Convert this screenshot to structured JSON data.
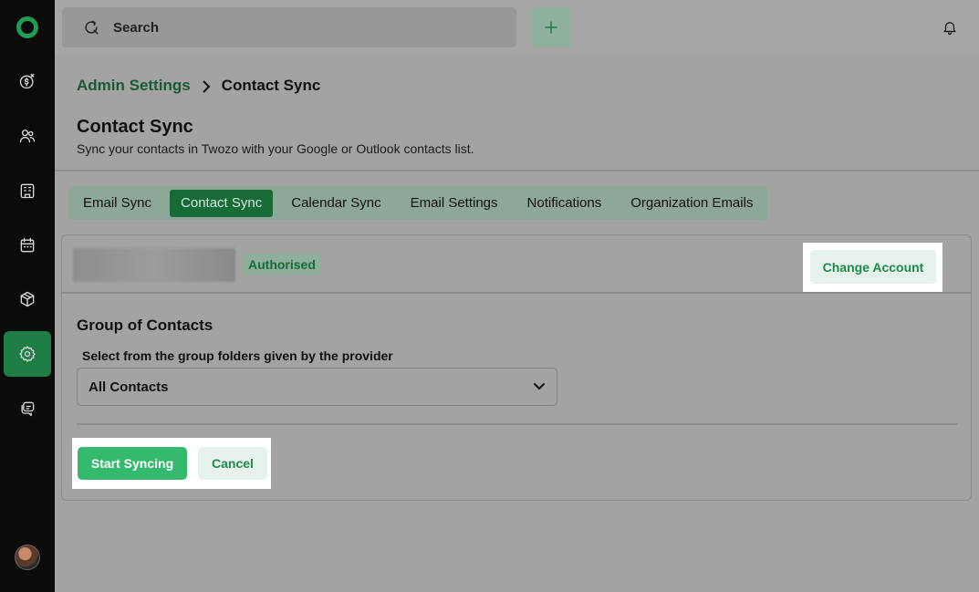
{
  "topbar": {
    "search_placeholder": "Search",
    "add_icon": "plus-icon",
    "bell_icon": "bell-icon"
  },
  "sidebar": {
    "items": [
      {
        "name": "deals",
        "icon": "dollar-icon"
      },
      {
        "name": "contacts",
        "icon": "users-icon"
      },
      {
        "name": "companies",
        "icon": "building-icon"
      },
      {
        "name": "calendar",
        "icon": "calendar-icon"
      },
      {
        "name": "products",
        "icon": "box-icon"
      },
      {
        "name": "settings",
        "icon": "gear-icon",
        "active": true
      },
      {
        "name": "chat",
        "icon": "chat-icon"
      }
    ]
  },
  "breadcrumb": {
    "parent": "Admin Settings",
    "current": "Contact Sync"
  },
  "page": {
    "title": "Contact Sync",
    "subtitle": "Sync your contacts in Twozo with your Google or Outlook contacts list."
  },
  "tabs": [
    {
      "label": "Email Sync"
    },
    {
      "label": "Contact Sync",
      "active": true
    },
    {
      "label": "Calendar Sync"
    },
    {
      "label": "Email Settings"
    },
    {
      "label": "Notifications"
    },
    {
      "label": "Organization Emails"
    }
  ],
  "account": {
    "status": "Authorised",
    "change_label": "Change Account"
  },
  "group": {
    "title": "Group of Contacts",
    "help": "Select from the group folders given by the provider",
    "selected": "All Contacts"
  },
  "actions": {
    "start_label": "Start Syncing",
    "cancel_label": "Cancel"
  },
  "colors": {
    "accent": "#1f8a4d",
    "sidebar_bg": "#0b0b0b",
    "active_tab": "#166b37"
  }
}
